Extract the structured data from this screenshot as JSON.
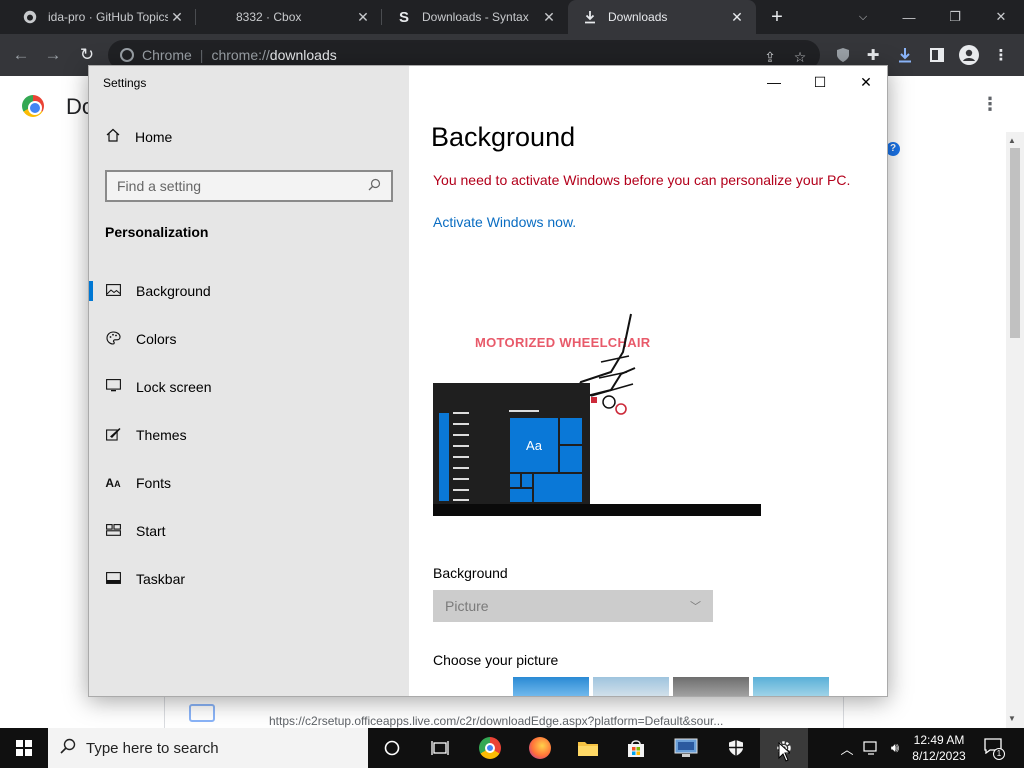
{
  "browser": {
    "tabs": [
      {
        "title": "ida-pro · GitHub Topics",
        "favicon": "github-icon"
      },
      {
        "title": "8332 · Cbox",
        "favicon": "cbox-icon"
      },
      {
        "title": "Downloads - Syntax",
        "favicon": "syntax-s-icon",
        "favicon_text": "S"
      },
      {
        "title": "Downloads",
        "favicon": "download-icon",
        "active": true
      }
    ],
    "omnibox": {
      "site_label": "Chrome",
      "url_scheme": "chrome://",
      "url_host": "downloads"
    }
  },
  "downloads_page": {
    "title": "Do",
    "item_url": "https://c2rsetup.officeapps.live.com/c2r/downloadEdge.aspx?platform=Default&sour..."
  },
  "settings": {
    "window_title": "Settings",
    "home_label": "Home",
    "search_placeholder": "Find a setting",
    "section_title": "Personalization",
    "nav": [
      {
        "label": "Background",
        "icon": "picture-icon",
        "selected": true
      },
      {
        "label": "Colors",
        "icon": "palette-icon"
      },
      {
        "label": "Lock screen",
        "icon": "lock-screen-icon"
      },
      {
        "label": "Themes",
        "icon": "themes-brush-icon"
      },
      {
        "label": "Fonts",
        "icon": "fonts-icon"
      },
      {
        "label": "Start",
        "icon": "start-icon"
      },
      {
        "label": "Taskbar",
        "icon": "taskbar-icon"
      }
    ],
    "page_heading": "Background",
    "activation_warning": "You need to activate Windows before you can personalize your PC.",
    "activate_link": "Activate Windows now.",
    "preview": {
      "wallpaper_text": "MOTORIZED WHEELCHAIR",
      "tile_label": "Aa"
    },
    "background_label": "Background",
    "background_value": "Picture",
    "choose_picture_label": "Choose your picture"
  },
  "taskbar": {
    "search_placeholder": "Type here to search",
    "time": "12:49 AM",
    "date": "8/12/2023",
    "notification_count": "1"
  },
  "colors": {
    "accent": "#0078d4",
    "warning": "#b3001b",
    "link": "#0a6dc2"
  }
}
